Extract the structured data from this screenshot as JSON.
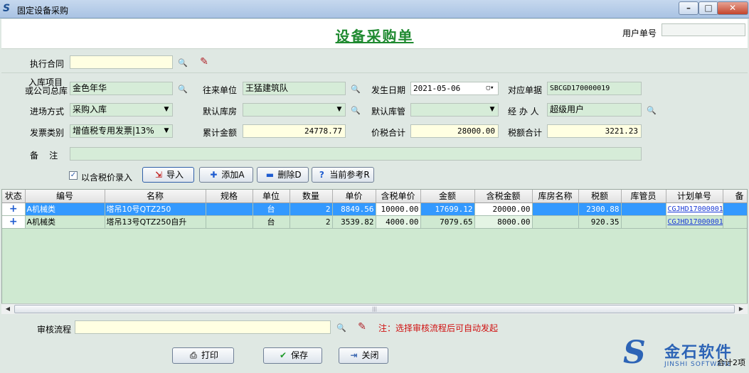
{
  "window": {
    "title": "固定设备采购"
  },
  "header": {
    "doc_title": "设备采购单",
    "user_no_label": "用户单号",
    "user_no_value": ""
  },
  "form": {
    "contract_label": "执行合同",
    "contract_value": "",
    "project_label_line1": "入库项目",
    "project_label_line2": "或公司总库",
    "project_value": "金色年华",
    "partner_label": "往来单位",
    "partner_value": "王猛建筑队",
    "date_label": "发生日期",
    "date_value": "2021-05-06",
    "ref_label": "对应单据",
    "ref_value": "SBCGD170000019",
    "entry_label": "进场方式",
    "entry_value": "采购入库",
    "warehouse_label": "默认库房",
    "warehouse_value": "",
    "keeper_label": "默认库管",
    "keeper_value": "",
    "handler_label": "经 办 人",
    "handler_value": "超级用户",
    "invoice_label": "发票类别",
    "invoice_value": "增值税专用发票|13%",
    "total_label": "累计金额",
    "total_value": "24778.77",
    "tax_total_label": "价税合计",
    "tax_total_value": "28000.00",
    "tax_label": "税额合计",
    "tax_value": "3221.23",
    "remark_label": "备    注",
    "remark_value": ""
  },
  "actions": {
    "include_tax_label": "以含税价录入",
    "include_tax_checked": true,
    "import_label": "导入",
    "add_label": "添加A",
    "delete_label": "删除D",
    "reference_label": "当前参考R"
  },
  "table": {
    "columns": [
      "状态",
      "编号",
      "名称",
      "规格",
      "单位",
      "数量",
      "单价",
      "含税单价",
      "金额",
      "含税金额",
      "库房名称",
      "税额",
      "库管员",
      "计划单号",
      "备"
    ],
    "rows": [
      {
        "state": "+",
        "code": "A机械类",
        "name": "塔吊10号QTZ250",
        "spec": "",
        "unit": "台",
        "qty": "2",
        "price": "8849.56",
        "tax_price": "10000.00",
        "amount": "17699.12",
        "tax_amount": "20000.00",
        "store": "",
        "tax": "2300.88",
        "keeper": "",
        "plan_no": "CGJHD17000001",
        "selected": true
      },
      {
        "state": "+",
        "code": "A机械类",
        "name": "塔吊13号QTZ250自升",
        "spec": "",
        "unit": "台",
        "qty": "2",
        "price": "3539.82",
        "tax_price": "4000.00",
        "amount": "7079.65",
        "tax_amount": "8000.00",
        "store": "",
        "tax": "920.35",
        "keeper": "",
        "plan_no": "CGJHD17000001",
        "selected": false
      }
    ]
  },
  "workflow": {
    "label": "审核流程",
    "value": "",
    "note": "注：选择审核流程后可自动发起"
  },
  "footer": {
    "print_label": "打印",
    "save_label": "保存",
    "close_label": "关闭",
    "total_count": "合计2项"
  },
  "logo": {
    "cn": "金石软件",
    "en": "JINSHI SOFTWARE"
  },
  "colors": {
    "field_green": "#d6ecd8",
    "field_yellow": "#ffffe2",
    "title_green": "#1f8a30",
    "selected_row": "#3399ff",
    "note_red": "#d01010"
  }
}
